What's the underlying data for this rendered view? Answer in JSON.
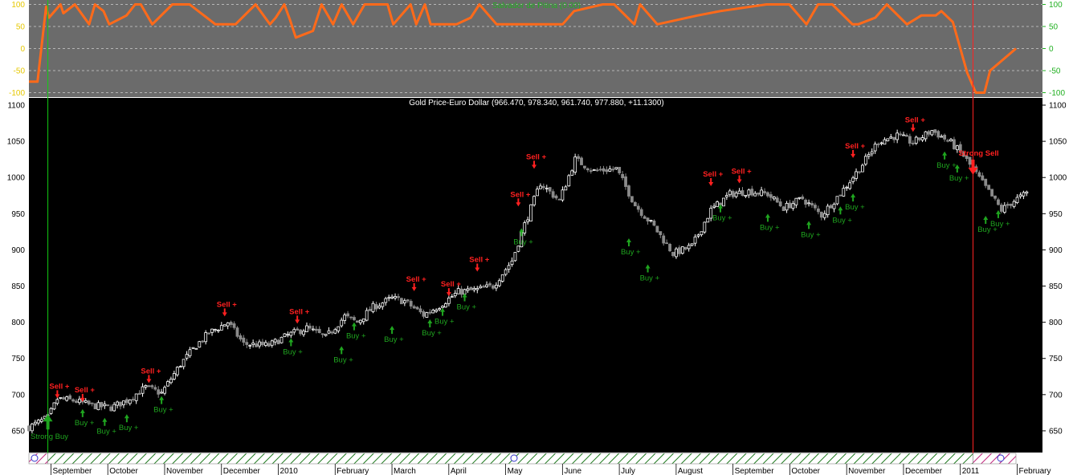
{
  "colors": {
    "indicator_bg": "#6b6b6b",
    "main_bg": "#000000",
    "axis_bg": "#ffffff",
    "indicator_line": "#ff6a1a",
    "indicator_axis_text": "#21b021",
    "buy_color": "#1fa51f",
    "sell_color": "#ff2020",
    "candle_up": "#ffffff",
    "candle_down": "#8a8a8a",
    "vline_buy": "#11cc11",
    "vline_sell": "#ff2222",
    "hatch": "#1d7a1d"
  },
  "chart_data": [
    {
      "type": "line",
      "panel": "indicator",
      "title": "Salvador de Pitina (0.00)",
      "y_ticks": [
        100,
        50,
        0,
        -50,
        -100
      ],
      "ylim": [
        -110,
        110
      ],
      "x": [
        0,
        1,
        3,
        6,
        7,
        11,
        12,
        16,
        21,
        23,
        26,
        28,
        34,
        37,
        39,
        43,
        50,
        56,
        65,
        72,
        79,
        84,
        86,
        89,
        91,
        93,
        99,
        102,
        106,
        109,
        113,
        117,
        125,
        127,
        133,
        135,
        138,
        140,
        149,
        154,
        157,
        163,
        172,
        182,
        186,
        190,
        200,
        204,
        211,
        213,
        219,
        233,
        241,
        257,
        265,
        271,
        275,
        280,
        287,
        289,
        295,
        299,
        306,
        311,
        316,
        318,
        322,
        327,
        330,
        333,
        335,
        344
      ],
      "values": [
        -75,
        -75,
        -75,
        95,
        70,
        100,
        80,
        100,
        55,
        100,
        85,
        55,
        75,
        100,
        100,
        55,
        100,
        100,
        55,
        55,
        100,
        55,
        70,
        100,
        65,
        25,
        40,
        100,
        55,
        100,
        55,
        100,
        100,
        55,
        100,
        55,
        100,
        55,
        55,
        70,
        100,
        55,
        55,
        55,
        55,
        85,
        100,
        100,
        55,
        100,
        55,
        75,
        85,
        100,
        100,
        55,
        100,
        100,
        55,
        55,
        70,
        100,
        55,
        75,
        75,
        85,
        60,
        -55,
        -100,
        -100,
        -50,
        0
      ]
    },
    {
      "type": "candlestick",
      "panel": "price",
      "title": "Gold Price-Euro Dollar (966.470, 978.340, 961.740, 977.880, +11.1300)",
      "ylim": [
        620,
        1110
      ],
      "y_ticks": [
        1100,
        1050,
        1000,
        950,
        900,
        850,
        800,
        750,
        700,
        650
      ],
      "x_ticks": [
        "September",
        "October",
        "November",
        "December",
        "2010",
        "February",
        "March",
        "April",
        "May",
        "June",
        "July",
        "August",
        "September",
        "October",
        "November",
        "December",
        "2011",
        "February"
      ],
      "x_tick_positions": [
        4,
        22,
        40,
        58,
        76,
        94,
        112,
        130,
        148,
        166,
        184,
        202,
        220,
        238,
        256,
        274,
        292,
        310
      ],
      "x_domain": [
        -4,
        317
      ],
      "close_points": {
        "x": [
          -4,
          2,
          5,
          10,
          16,
          22,
          27,
          33,
          38,
          44,
          49,
          53,
          59,
          64,
          72,
          78,
          84,
          90,
          96,
          100,
          105,
          111,
          115,
          121,
          126,
          132,
          138,
          143,
          149,
          153,
          158,
          164,
          169,
          175,
          182,
          188,
          194,
          200,
          206,
          212,
          218,
          224,
          230,
          235,
          241,
          247,
          253,
          259,
          265,
          271,
          276,
          282,
          288,
          292,
          296,
          300,
          304,
          308,
          312
        ],
        "values": [
          655,
          668,
          694,
          692,
          685,
          682,
          692,
          710,
          702,
          742,
          768,
          785,
          800,
          770,
          768,
          782,
          792,
          779,
          808,
          800,
          821,
          833,
          829,
          810,
          823,
          842,
          845,
          850,
          885,
          935,
          992,
          968,
          1025,
          1009,
          1012,
          962,
          932,
          895,
          905,
          955,
          977,
          981,
          977,
          958,
          971,
          948,
          978,
          1012,
          1050,
          1058,
          1048,
          1065,
          1048,
          1030,
          1005,
          980,
          955,
          968,
          978
        ]
      },
      "signals": {
        "buy": {
          "label": "Buy +",
          "points": [
            {
              "x": 13,
              "y": 680
            },
            {
              "x": 20,
              "y": 668
            },
            {
              "x": 27,
              "y": 673
            },
            {
              "x": 38,
              "y": 698
            },
            {
              "x": 79,
              "y": 778
            },
            {
              "x": 95,
              "y": 767
            },
            {
              "x": 99,
              "y": 800
            },
            {
              "x": 111,
              "y": 795
            },
            {
              "x": 123,
              "y": 804
            },
            {
              "x": 127,
              "y": 820
            },
            {
              "x": 134,
              "y": 840
            },
            {
              "x": 152,
              "y": 930
            },
            {
              "x": 186,
              "y": 916
            },
            {
              "x": 192,
              "y": 880
            },
            {
              "x": 215,
              "y": 963
            },
            {
              "x": 230,
              "y": 950
            },
            {
              "x": 243,
              "y": 940
            },
            {
              "x": 253,
              "y": 960
            },
            {
              "x": 257,
              "y": 978
            },
            {
              "x": 286,
              "y": 1036
            },
            {
              "x": 290,
              "y": 1018
            },
            {
              "x": 299,
              "y": 947
            },
            {
              "x": 303,
              "y": 955
            }
          ]
        },
        "sell": {
          "label": "Sell +",
          "points": [
            {
              "x": 5,
              "y": 695
            },
            {
              "x": 13,
              "y": 690
            },
            {
              "x": 34,
              "y": 716
            },
            {
              "x": 58,
              "y": 808
            },
            {
              "x": 81,
              "y": 798
            },
            {
              "x": 118,
              "y": 843
            },
            {
              "x": 129,
              "y": 836
            },
            {
              "x": 138,
              "y": 870
            },
            {
              "x": 151,
              "y": 960
            },
            {
              "x": 156,
              "y": 1012
            },
            {
              "x": 212,
              "y": 988
            },
            {
              "x": 221,
              "y": 992
            },
            {
              "x": 257,
              "y": 1027
            },
            {
              "x": 276,
              "y": 1063
            }
          ]
        },
        "strong_buy": {
          "label": "Strong Buy",
          "x": 2,
          "y": 653
        },
        "strong_sell": {
          "label": "Strong Sell",
          "x": 295,
          "y": 1017
        }
      }
    }
  ]
}
